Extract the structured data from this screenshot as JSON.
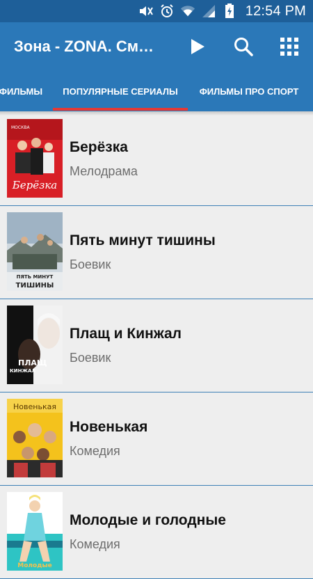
{
  "status_bar": {
    "time": "12:54 PM",
    "icons": [
      "mute-icon",
      "alarm-icon",
      "wifi-icon",
      "signal-icon",
      "battery-icon"
    ]
  },
  "app_bar": {
    "title": "Зона - ZONA. См…",
    "actions": [
      "play-icon",
      "search-icon",
      "grid-menu-icon"
    ]
  },
  "tabs": [
    {
      "label": "ФИЛЬМЫ",
      "selected": false
    },
    {
      "label": "ПОПУЛЯРНЫЕ СЕРИАЛЫ",
      "selected": true
    },
    {
      "label": "ФИЛЬМЫ ПРО СПОРТ",
      "selected": false
    }
  ],
  "colors": {
    "status_bar": "#1e5f99",
    "app_bar": "#2b78b8",
    "tab_indicator": "#e53935",
    "divider": "#3c7fb5",
    "background": "#eeeeee"
  },
  "list": {
    "items": [
      {
        "title": "Берёзка",
        "genre": "Мелодрама",
        "poster_text": "Берёзка"
      },
      {
        "title": "Пять минут тишины",
        "genre": "Боевик",
        "poster_text": "ПЯТЬ МИНУТ ТИШИНЫ"
      },
      {
        "title": "Плащ и Кинжал",
        "genre": "Боевик",
        "poster_text": "ПЛАЩ И КИНЖАЛ"
      },
      {
        "title": "Новенькая",
        "genre": "Комедия",
        "poster_text": "Новенькая"
      },
      {
        "title": "Молодые и голодные",
        "genre": "Комедия",
        "poster_text": "Молодые"
      }
    ]
  }
}
